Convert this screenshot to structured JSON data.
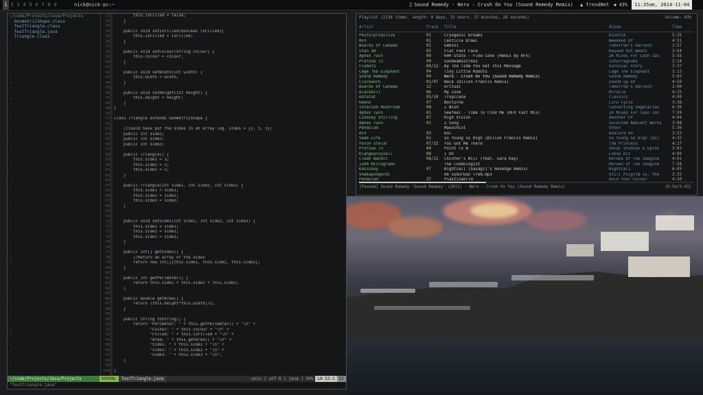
{
  "topbar": {
    "workspaces": [
      "1",
      "2",
      "3",
      "4",
      "5",
      "6",
      "7",
      "8",
      "9"
    ],
    "active_workspace": 0,
    "host": "nick@nick-pc:~",
    "nowplaying_icon": "♫",
    "nowplaying": "Sound Remedy - Nero - Crush On You (Sound Remedy Remix)",
    "network": "TrendNet",
    "volume": "43%",
    "clock": "11:35am, 2014-11-04"
  },
  "vim": {
    "tree": [
      {
        "text": "~/code/Projects/Java/Projects",
        "head": true
      },
      {
        "text": "  GeometricShape.class",
        "head": false
      },
      {
        "text": "  TestTriangle.class",
        "head": false
      },
      {
        "text": "  TestTriangle.java",
        "head": false
      },
      {
        "text": "  Triangle.class",
        "head": false
      }
    ],
    "tilde_count": 65,
    "line_numbers": [
      "31",
      "32",
      "33",
      "34",
      "35",
      "36",
      "37",
      "38",
      "39",
      "40",
      "41",
      "42",
      "43",
      "44",
      "45",
      "46",
      "47",
      "48",
      "49",
      "50",
      "51",
      "52",
      "53",
      "54",
      "55",
      "56",
      "57",
      "58",
      "59",
      "60",
      "61",
      "62",
      "63",
      "64",
      "65",
      "66",
      "67",
      "68",
      "69",
      "70",
      "71",
      "72",
      "73",
      "74",
      "75",
      "76",
      "77",
      "78",
      "79",
      "80",
      "81",
      "82",
      "83",
      "84",
      "85",
      "86",
      "87",
      "88",
      "89",
      "90",
      "91",
      "92",
      "93",
      "94",
      "95",
      "96",
      "97",
      "98",
      "99",
      "100"
    ],
    "code": [
      "        this.isFilled = false;",
      "    }",
      "",
      "    public void setIsFilled(boolean isFilled){",
      "        this.isFilled = isFilled;",
      "    }",
      "",
      "    public void setColour(String colour) {",
      "        this.colour = colour;",
      "    }",
      "",
      "    public void setWidth(int width) {",
      "        this.width = width;",
      "    }",
      "",
      "    public void setHeight(int height) {",
      "        this.height = height;",
      "    }",
      "}",
      "",
      "class Triangle extends GeometricShape {",
      "",
      "    //Could have put the sides in an array (eg. sides = {3, 3, 3})",
      "    public int side1;",
      "    public int side2;",
      "    public int side3;",
      "",
      "    public Triangle() {",
      "        this.side1 = 3;",
      "        this.side2 = 3;",
      "        this.side3 = 3;",
      "    }",
      "",
      "    public Triangle(int side1, int side2, int side3) {",
      "        this.side1 = side1;",
      "        this.side2 = side2;",
      "        this.side3 = side3;",
      "    }",
      "",
      "",
      "    public void setSides(int side1, int side2, int side3) {",
      "        this.side1 = side1;",
      "        this.side2 = side2;",
      "        this.side3 = side3;",
      "    }",
      "",
      "    public int[] getSides() {",
      "        //Return an array of the sides",
      "        return new int[]{this.side1, this.side2, this.side3};",
      "    }",
      "",
      "    public int getPerimeter() {",
      "        return this.side1 + this.side2 + this.side3;",
      "    }",
      "",
      "    public double getArea() {",
      "        return (this.height*this.width)/2;",
      "    }",
      "",
      "    public String toString() {",
      "        return \"Perimeter: \" + this.getPerimeter() + \"\\n\" +",
      "               \"Colour: \" + this.colour + \"\\n\" +",
      "               \"Filled: \" + this.isFilled + \"\\n\" +",
      "               \"Area: \" + this.getArea() + \"\\n\" +",
      "               \"Side1: \" + this.side1 + \"\\n\" +",
      "               \"Side2: \" + this.side2 + \"\\n\" +",
      "               \"Side3: \" + this.side3 + \"\\n\";",
      "    }",
      "",
      "}"
    ],
    "status": {
      "path": "~/code/Projects/Java/Projects",
      "mode": "NORMAL",
      "file": "TestTriangle.java",
      "format": "unix | utf-8 | java | 50%",
      "position": "LN  52:1",
      "percent": "52"
    },
    "cmdline": "\"TestTriangle.java\""
  },
  "mpc": {
    "header": "Playlist (2136 items, length: 6 days, 15 hours, 37 minutes, 28 seconds)",
    "volume": "Volume: 43%",
    "columns": {
      "artist": "Artist",
      "track": "Track",
      "title": "Title",
      "album": "Album",
      "time": "Time"
    },
    "rows": [
      {
        "artist": "Phuturprimitive",
        "track": "01",
        "title": "Cryogenic Dreams",
        "album": "Kinetik",
        "time": "5:25"
      },
      {
        "artist": "RFX",
        "track": "01",
        "title": "Centicle Drawl",
        "album": "Weekend EP",
        "time": "4:51"
      },
      {
        "artist": "Boards Of Canada",
        "track": "01",
        "title": "Gemini",
        "album": "Tomorrow's Harvest",
        "time": "2:57"
      },
      {
        "artist": "Stan SB",
        "track": "02",
        "title": "Flat Foot Face",
        "album": "Housed Out Beats",
        "time": "3:54"
      },
      {
        "artist": "Aphex Twin",
        "track": "06",
        "title": "000 State - Flow Cone (Remix By RFX)",
        "album": "26 Mixes For Cash CD2",
        "time": "5:55"
      },
      {
        "artist": "Prefuse 73",
        "track": "09",
        "title": "Sunbeamsstress",
        "album": "Interregnums",
        "time": "2:14"
      },
      {
        "artist": "Flobots",
        "track": "06/12",
        "title": "By The Time You Get This Message",
        "album": "Survival Story",
        "time": "3:37"
      },
      {
        "artist": "Cage The Elephant",
        "track": "04",
        "title": "Tiny Little Robots",
        "album": "Cage The Elephant",
        "time": "3:13"
      },
      {
        "artist": "Sound Remedy",
        "track": "00",
        "title": "Nero - Crush On You (Sound Remedy Remix)",
        "album": "Sound Remedy",
        "time": "5:03",
        "playing": true
      },
      {
        "artist": "Clockwork",
        "track": "01/07",
        "title": "Walk (Dillon Francis Remix)",
        "album": "Sound up EP",
        "time": "4:50"
      },
      {
        "artist": "Boards Of Canada",
        "track": "12",
        "title": "Uritual",
        "album": "Tomorrow's Harvest",
        "time": "2:00"
      },
      {
        "artist": "Blackbill",
        "track": "06",
        "title": "My Love",
        "album": "Miracle",
        "time": "4:25"
      },
      {
        "artist": "Ratatat",
        "track": "05/10",
        "title": "Tropicana",
        "album": "Classics",
        "time": "4:09"
      },
      {
        "artist": "Keeno",
        "track": "07",
        "title": "Nocturne",
        "album": "Life Cycle",
        "time": "3:38"
      },
      {
        "artist": "Infected Mushroom",
        "track": "08",
        "title": "I Wish",
        "album": "Converting Vegetarian",
        "time": "6:39"
      },
      {
        "artist": "Aphex Twin",
        "track": "01",
        "title": "Seefeel - Time To Find Me (RFX Fast Mix)",
        "album": "26 Mixes For Cash CD2",
        "time": "7:59"
      },
      {
        "artist": "Lindsey Stirling",
        "track": "07",
        "title": "High Vision",
        "album": "Another EP",
        "time": "4:04"
      },
      {
        "artist": "Aphex Twin",
        "track": "01",
        "title": "Z Song",
        "album": "Selected Ambient Works",
        "time": "3:08"
      },
      {
        "artist": "Pendulum",
        "track": "",
        "title": "Masochist",
        "album": "Other",
        "time": "5:36"
      },
      {
        "artist": "RFX",
        "track": "03",
        "title": "6SC",
        "album": "Analord 09",
        "time": "3:53"
      },
      {
        "artist": "Sade Life",
        "track": "01",
        "title": "So Young So High (Dillon Francis Remix)",
        "album": "So Young So High (Dil",
        "time": "4:32"
      },
      {
        "artist": "Parov Stelar",
        "track": "07/15",
        "title": "You Got Me There",
        "album": "The Princess",
        "time": "4:27"
      },
      {
        "artist": "Prefuse 73",
        "track": "04",
        "title": "Point To B",
        "album": "Vocal Studies & Uprok",
        "time": "3:03"
      },
      {
        "artist": "Klangkarussell",
        "track": "08",
        "title": "I Oh",
        "album": "Loose Kit",
        "time": "4:00"
      },
      {
        "artist": "Clean Bandit",
        "track": "06/11",
        "title": "Chinter's Will (feat. Sara Kay)",
        "album": "Heroes Of The Imagine",
        "time": "4:01"
      },
      {
        "artist": "1200 Micrograms",
        "track": "",
        "title": "The Cosmologist",
        "album": "Heroes Of The Imagine",
        "time": "7:58"
      },
      {
        "artist": "Kavinsky",
        "track": "07",
        "title": "Nightcall (Savagli's Revenge Remix)",
        "album": "Nightcall",
        "time": "6:05"
      },
      {
        "artist": "Shakaponguchi",
        "track": "",
        "title": "06 Suburban Trem.mp3",
        "album": "Still Pilgrim vs. the",
        "time": "3:32"
      },
      {
        "artist": "Pendulum",
        "track": "37",
        "title": "Plasticworld",
        "album": "Hold Your Colour",
        "time": "4:20"
      }
    ],
    "progress": 0.38,
    "status": "[Paused] Sound Remedy 'Sound Remedy' (2011) - Nero - Crush On You (Sound Remedy Remix)",
    "status_time": "[0:54/5:03]"
  }
}
